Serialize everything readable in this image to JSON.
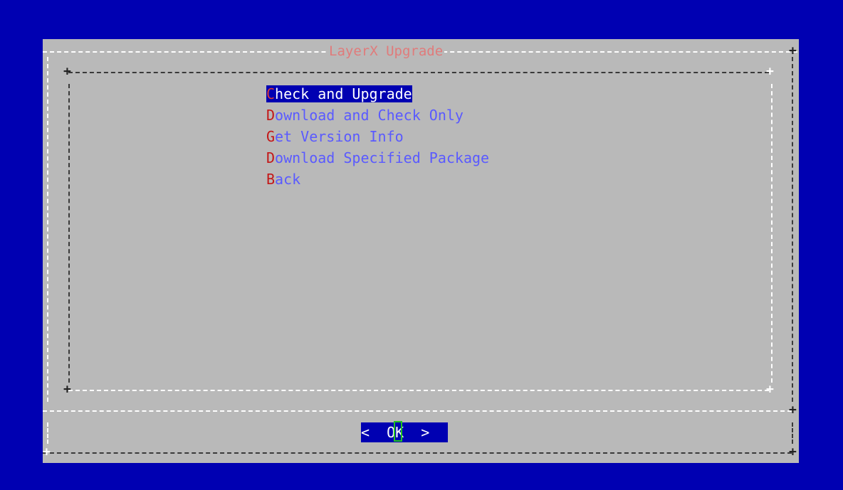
{
  "dialog": {
    "title": "LayerX Upgrade"
  },
  "menu": {
    "items": [
      {
        "hotkey": "C",
        "rest": "heck and Upgrade",
        "selected": true
      },
      {
        "hotkey": "D",
        "rest": "ownload and Check Only",
        "selected": false
      },
      {
        "hotkey": "G",
        "rest": "et Version Info",
        "selected": false
      },
      {
        "hotkey": "D",
        "rest": "ownload Specified Package",
        "selected": false
      },
      {
        "hotkey": "B",
        "rest": "ack",
        "selected": false
      }
    ]
  },
  "buttons": {
    "ok_label": "<  OK  >"
  },
  "colors": {
    "background": "#0000b2",
    "dialog": "#b9b9b9",
    "title": "#e07b7b",
    "menu_text": "#5a5aff",
    "hotkey": "#c41616",
    "cursor": "#21c321"
  }
}
